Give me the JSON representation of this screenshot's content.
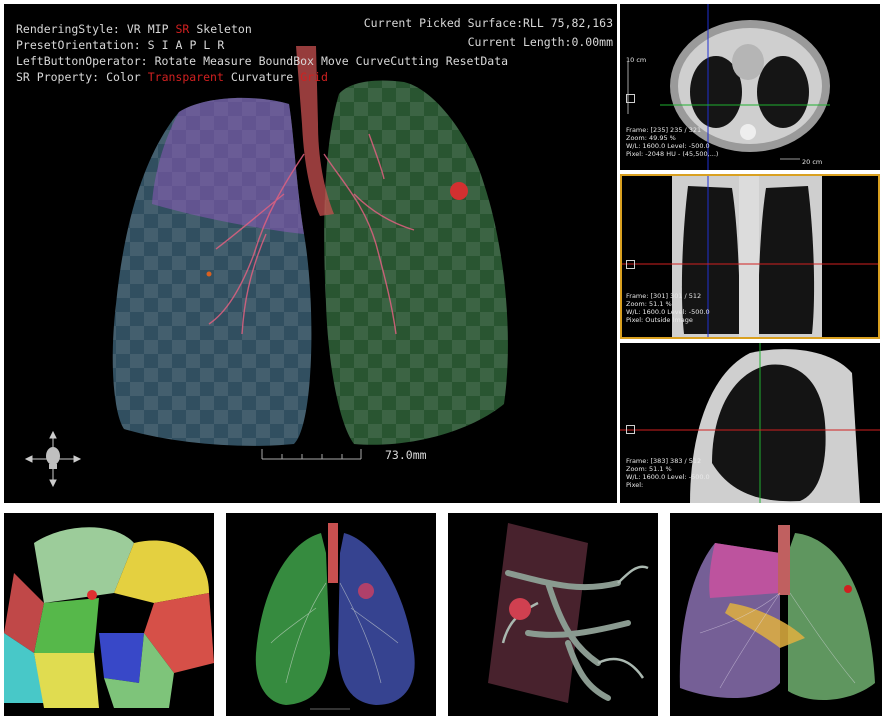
{
  "viewer": {
    "rendering_style": {
      "label": "RenderingStyle:",
      "options": [
        "VR",
        "MIP",
        "SR",
        "Skeleton"
      ],
      "active": "SR"
    },
    "preset_orientation": {
      "label": "PresetOrientation:",
      "options": [
        "S",
        "I",
        "A",
        "P",
        "L",
        "R"
      ]
    },
    "left_button_operator": {
      "label": "LeftButtonOperator:",
      "options": [
        "Rotate",
        "Measure",
        "BoundBox",
        "Move",
        "CurveCutting",
        "ResetData"
      ]
    },
    "sr_property": {
      "label": "SR Property:",
      "options": [
        "Color",
        "Transparent",
        "Curvature",
        "Grid"
      ],
      "active": [
        "Transparent",
        "Grid"
      ]
    },
    "picked_surface": "Current Picked Surface:RLL 75,82,163",
    "current_length": "Current Length:0.00mm",
    "scale_label": "73.0mm",
    "colors": {
      "overlay_text": "#d8d8d8",
      "active_option": "#d02020",
      "selected_border": "#d9a020"
    }
  },
  "slices": [
    {
      "view": "axial",
      "scale_label": "10 cm",
      "bottom_scale_label": "20 cm",
      "info": [
        "Frame: [235] 235 / 321",
        "Zoom: 49.95 %",
        "W/L: 1600.0 Level: -500.0",
        "Pixel: -2048 HU - (45,500,...)"
      ]
    },
    {
      "view": "coronal",
      "selected": true,
      "info": [
        "Frame: [301] 301 / 512",
        "Zoom: 51.1 %",
        "W/L: 1600.0 Level: -500.0",
        "Pixel: Outside Image"
      ]
    },
    {
      "view": "sagittal",
      "info": [
        "Frame: [383] 383 / 512",
        "Zoom: 51.1 %",
        "W/L: 1600.0 Level: -500.0",
        "Pixel:"
      ]
    }
  ],
  "thumbnails": [
    {
      "name": "lobe-segmentation"
    },
    {
      "name": "lungs-green-blue"
    },
    {
      "name": "vessel-tree-closeup"
    },
    {
      "name": "lungs-multicolor"
    }
  ]
}
